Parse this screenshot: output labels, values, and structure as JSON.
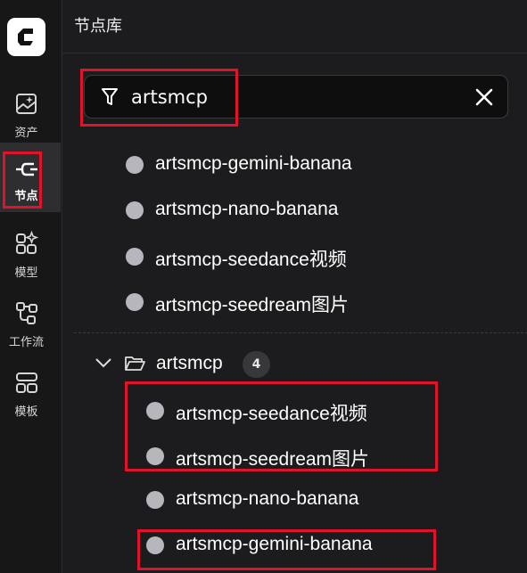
{
  "sidebar": {
    "logo_icon": "app-logo-icon",
    "items": [
      {
        "label": "资产",
        "icon": "image-sparkle-icon"
      },
      {
        "label": "节点",
        "icon": "node-link-icon",
        "active": true
      },
      {
        "label": "模型",
        "icon": "model-grid-icon"
      },
      {
        "label": "工作流",
        "icon": "workflow-icon"
      },
      {
        "label": "模板",
        "icon": "template-icon"
      }
    ]
  },
  "panel": {
    "title": "节点库",
    "search": {
      "value": "artsmcp",
      "filter_icon": "filter-icon",
      "clear_icon": "close-icon"
    },
    "results": [
      "artsmcp-gemini-banana",
      "artsmcp-nano-banana",
      "artsmcp-seedance视频",
      "artsmcp-seedream图片"
    ],
    "group": {
      "name": "artsmcp",
      "count": "4",
      "expanded": true,
      "items": [
        "artsmcp-seedance视频",
        "artsmcp-seedream图片",
        "artsmcp-nano-banana",
        "artsmcp-gemini-banana"
      ]
    }
  },
  "colors": {
    "highlight": "#e0132a",
    "node_dot": "#b6b6bc",
    "background": "#1c1c1e"
  }
}
